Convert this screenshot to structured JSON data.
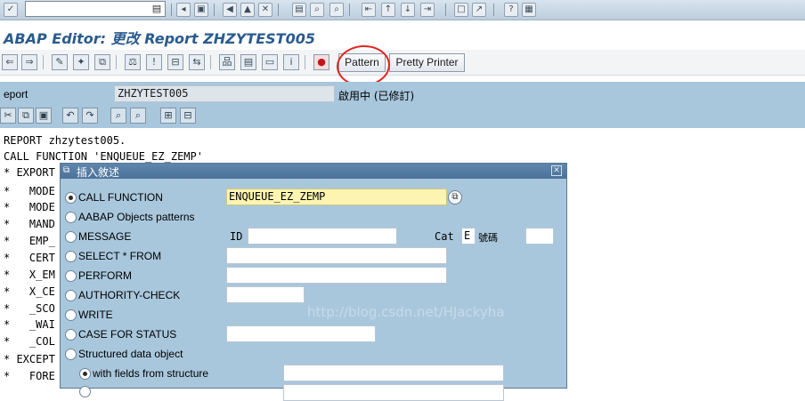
{
  "window": {
    "title": "ABAP Editor: 更改 Report ZHZYTEST005"
  },
  "system_toolbar": {
    "command_field_value": "",
    "icons": [
      "check-icon",
      "save-icon",
      "back-icon",
      "exit-icon",
      "cancel-icon",
      "print-icon",
      "find-icon",
      "find-next-icon",
      "first-page-icon",
      "previous-page-icon",
      "next-page-icon",
      "last-page-icon",
      "new-session-icon",
      "shortcut-icon",
      "help-icon",
      "layout-icon"
    ]
  },
  "app_toolbar": {
    "pattern_label": "Pattern",
    "pretty_printer_label": "Pretty Printer"
  },
  "program_header": {
    "report_label": "eport",
    "program_name": "ZHZYTEST005",
    "status": "啟用中 (已修訂)"
  },
  "code_lines": [
    "REPORT zhzytest005.",
    "CALL FUNCTION 'ENQUEUE_EZ_ZEMP'",
    "* EXPORT",
    "*   MODE",
    "*   MODE",
    "*   MAND",
    "*   EMP_",
    "*   CERT",
    "*   X_EM",
    "*   X_CE",
    "*   _SCO",
    "*   _WAI",
    "*   _COL",
    "* EXCEPT",
    "*   FORE"
  ],
  "dialog": {
    "title": "插入敘述",
    "options": [
      {
        "label": "CALL FUNCTION",
        "selected": true
      },
      {
        "label": "AABAP Objects patterns",
        "selected": false
      },
      {
        "label": "MESSAGE",
        "selected": false
      },
      {
        "label": "SELECT * FROM",
        "selected": false
      },
      {
        "label": "PERFORM",
        "selected": false
      },
      {
        "label": "AUTHORITY-CHECK",
        "selected": false
      },
      {
        "label": "WRITE",
        "selected": false
      },
      {
        "label": "CASE FOR STATUS",
        "selected": false
      },
      {
        "label": "Structured data object",
        "selected": false
      }
    ],
    "sub_option": {
      "label": "with fields from structure",
      "selected": true
    },
    "call_function_value": "ENQUEUE_EZ_ZEMP",
    "message_id_label": "ID",
    "message_id_value": "",
    "category_label": "Cat",
    "category_value": "E",
    "number_label": "號碼",
    "number_value": ""
  },
  "watermark": "http://blog.csdn.net/HJackyha"
}
